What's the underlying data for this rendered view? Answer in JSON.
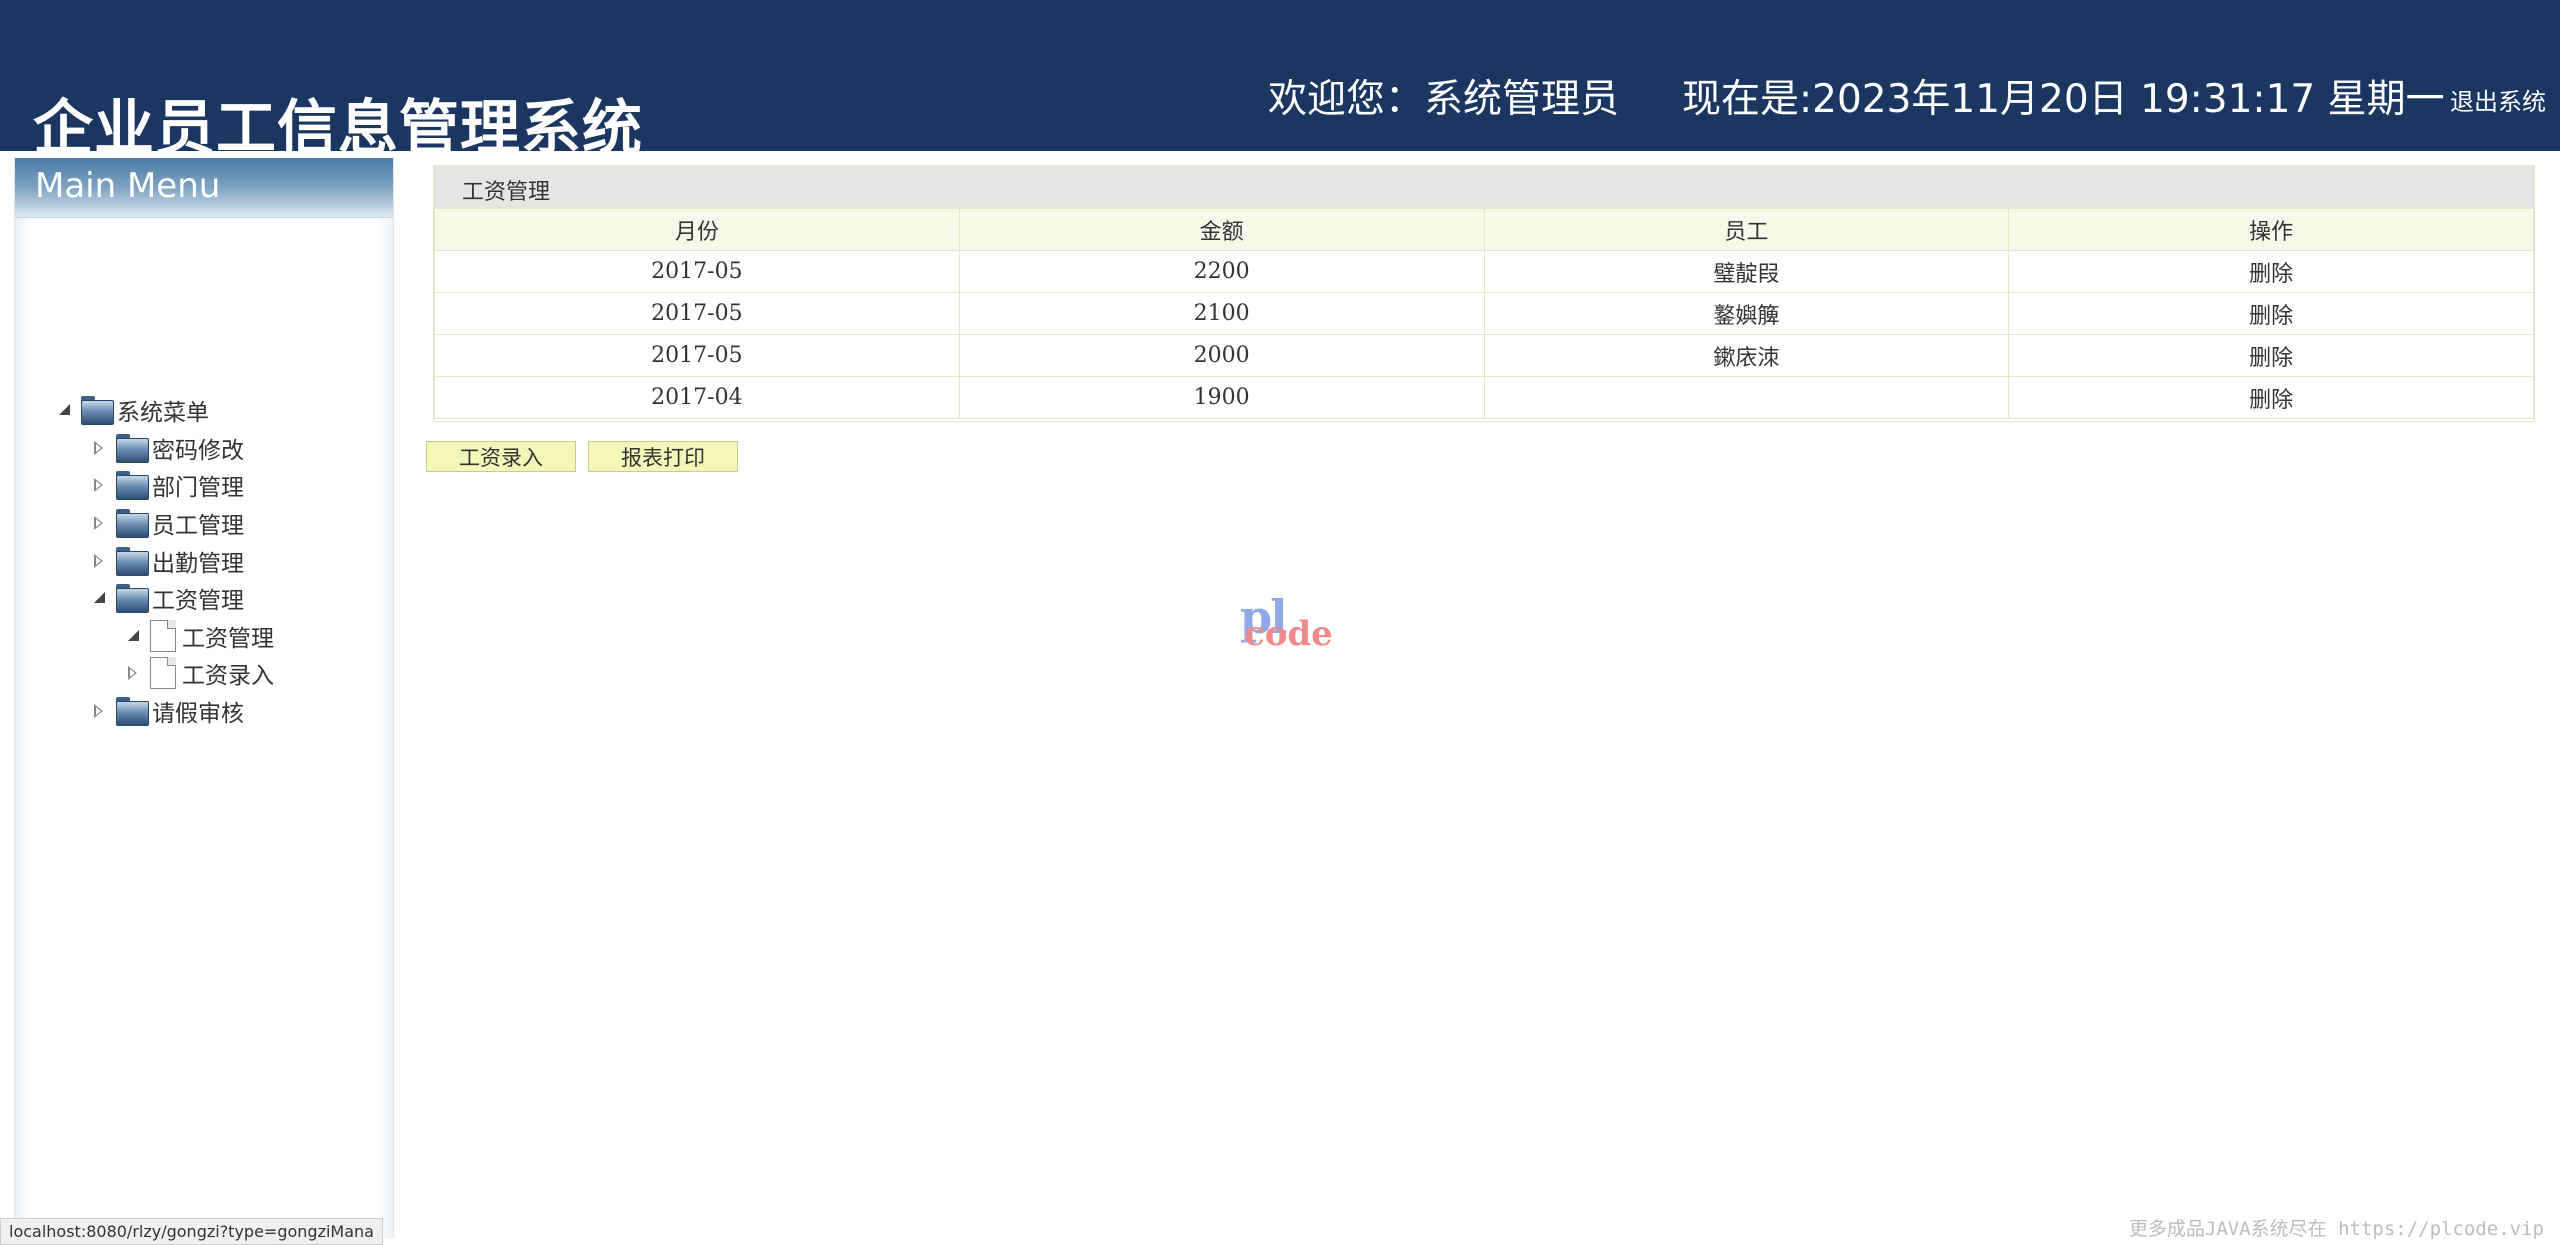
{
  "header": {
    "title": "企业员工信息管理系统",
    "welcome": "欢迎您：系统管理员",
    "clock": "现在是:2023年11月20日 19:31:17 星期一",
    "logout": "退出系统"
  },
  "menu": {
    "title": "Main Menu",
    "root": "系统菜单",
    "items": [
      {
        "label": "密码修改"
      },
      {
        "label": "部门管理"
      },
      {
        "label": "员工管理"
      },
      {
        "label": "出勤管理"
      },
      {
        "label": "工资管理",
        "children": [
          {
            "label": "工资管理"
          },
          {
            "label": "工资录入"
          }
        ]
      },
      {
        "label": "请假审核"
      }
    ]
  },
  "panel": {
    "title": "工资管理",
    "columns": [
      "月份",
      "金额",
      "员工",
      "操作"
    ],
    "rows": [
      {
        "month": "2017-05",
        "amount": "2200",
        "employee": "璧靛叚",
        "action": "删除"
      },
      {
        "month": "2017-05",
        "amount": "2100",
        "employee": "鐜嬩簲",
        "action": "删除"
      },
      {
        "month": "2017-05",
        "amount": "2000",
        "employee": "鏉庡洓",
        "action": "删除"
      },
      {
        "month": "2017-04",
        "amount": "1900",
        "employee": "",
        "action": "删除"
      }
    ]
  },
  "buttons": {
    "add": "工资录入",
    "print": "报表打印"
  },
  "watermark": {
    "top": "pl",
    "bottom": "code"
  },
  "status_url": "localhost:8080/rlzy/gongzi?type=gongziMana",
  "footer_note": "更多成品JAVA系统尽在 https://plcode.vip"
}
